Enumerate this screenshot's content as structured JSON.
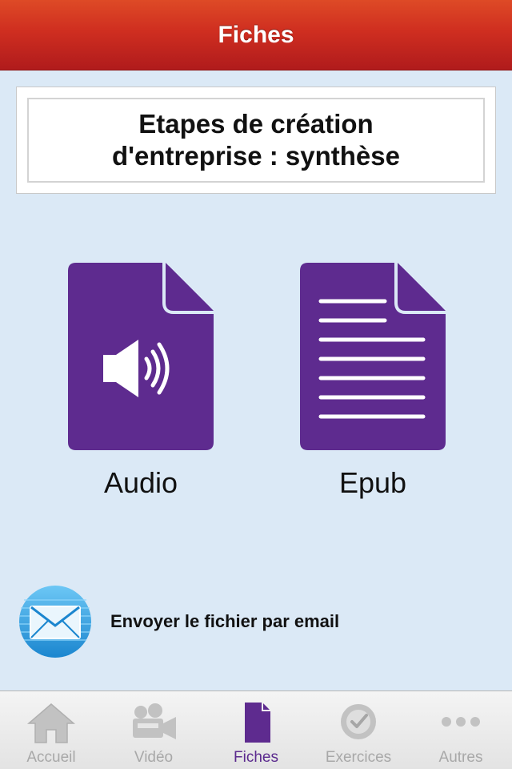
{
  "nav": {
    "title": "Fiches"
  },
  "document": {
    "title": "Etapes de création d'entreprise : synthèse"
  },
  "files": [
    {
      "label": "Audio",
      "icon": "audio-file-icon"
    },
    {
      "label": "Epub",
      "icon": "document-file-icon"
    }
  ],
  "email": {
    "label": "Envoyer le fichier par email",
    "icon": "envelope-icon"
  },
  "tabs": [
    {
      "label": "Accueil",
      "icon": "home-icon"
    },
    {
      "label": "Vidéo",
      "icon": "video-camera-icon"
    },
    {
      "label": "Fiches",
      "icon": "document-icon",
      "active": true
    },
    {
      "label": "Exercices",
      "icon": "checkmark-badge-icon"
    },
    {
      "label": "Autres",
      "icon": "more-icon"
    }
  ],
  "colors": {
    "nav": "#cf2e20",
    "accent": "#5e2b8f",
    "background": "#dbe9f6",
    "email": "#2a9fdf"
  }
}
